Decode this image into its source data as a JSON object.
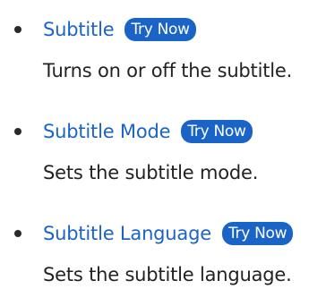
{
  "settings": {
    "items": [
      {
        "title": "Subtitle",
        "try_label": "Try Now",
        "description": "Turns on or off the subtitle."
      },
      {
        "title": "Subtitle Mode",
        "try_label": "Try Now",
        "description": "Sets the subtitle mode."
      },
      {
        "title": "Subtitle Language",
        "try_label": "Try Now",
        "description": "Sets the subtitle language."
      }
    ]
  },
  "colors": {
    "link": "#1a64c8",
    "badge_bg": "#1a64c8",
    "badge_text": "#ffffff",
    "body_text": "#222222",
    "bullet": "#2a2a2a"
  }
}
